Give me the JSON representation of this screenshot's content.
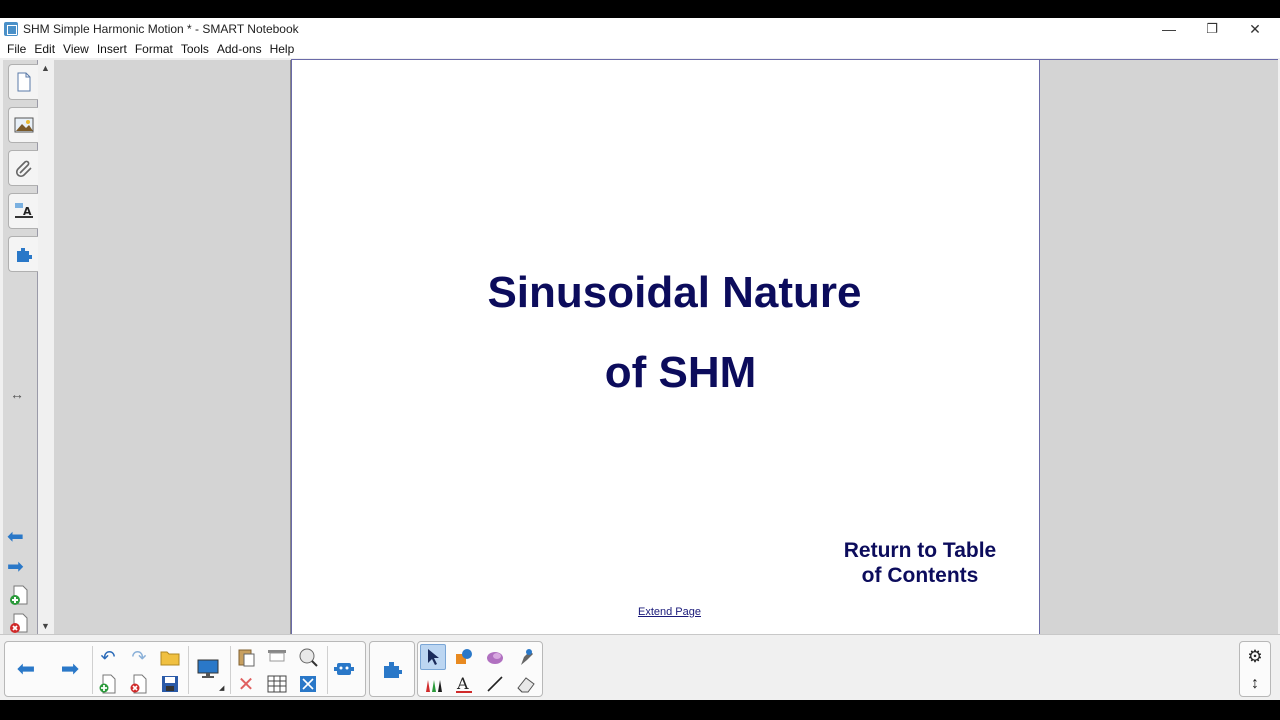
{
  "window": {
    "title": "SHM Simple Harmonic Motion * - SMART Notebook",
    "minimize": "—",
    "restore": "❐",
    "close": "✕"
  },
  "menu": [
    "File",
    "Edit",
    "View",
    "Insert",
    "Format",
    "Tools",
    "Add-ons",
    "Help"
  ],
  "page": {
    "heading_line1": "Sinusoidal Nature",
    "heading_line2": "of SHM",
    "return_line1": "Return to Table",
    "return_line2": "of Contents",
    "extend_page": "Extend Page"
  },
  "colors": {
    "heading": "#0c0c5c",
    "accent": "#2a78c8"
  },
  "icons": {
    "sidebar": [
      "page-sorter-icon",
      "gallery-icon",
      "attachments-icon",
      "properties-icon",
      "addons-icon"
    ],
    "toolbar": [
      "previous-page-icon",
      "next-page-icon",
      "undo-icon",
      "redo-icon",
      "open-icon",
      "add-page-icon",
      "delete-page-icon",
      "save-icon",
      "display-icon",
      "paste-icon",
      "delete-icon",
      "screen-shade-icon",
      "table-icon",
      "full-screen-icon",
      "zoom-icon",
      "response-icon",
      "addons-icon",
      "select-icon",
      "shapes-icon",
      "fill-icon",
      "magic-pen-icon",
      "pens-icon",
      "text-icon",
      "line-icon",
      "eraser-icon",
      "settings-icon",
      "move-toolbar-icon"
    ]
  }
}
